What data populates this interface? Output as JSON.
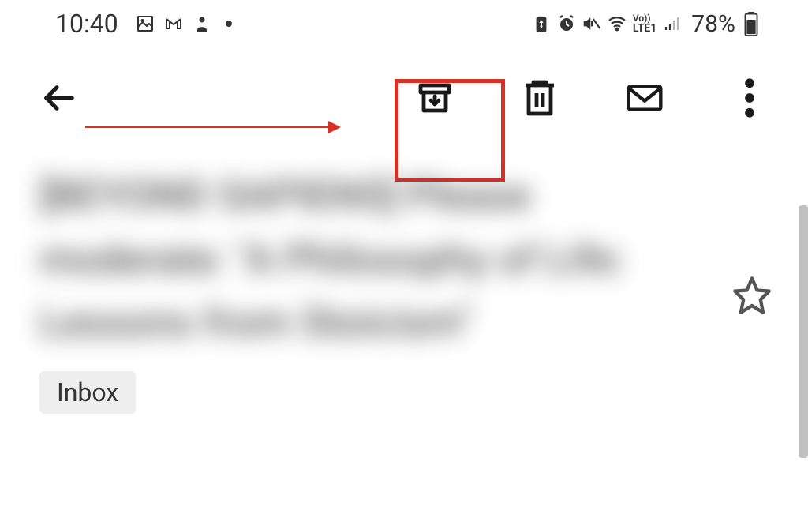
{
  "status_bar": {
    "time": "10:40",
    "battery_pct": "78%",
    "lte": "LTE1",
    "vo": "Vo))"
  },
  "toolbar": {
    "back": "back",
    "archive": "archive",
    "delete": "delete",
    "mark_unread": "mark-unread",
    "more": "more"
  },
  "content": {
    "blurred_subject": "[BEYOND SAPIENS] Please moderate: \"A Philosophy of Life: Lessons from Stoicism\"",
    "label": "Inbox"
  },
  "annotation": {
    "highlight_target": "archive-button"
  }
}
